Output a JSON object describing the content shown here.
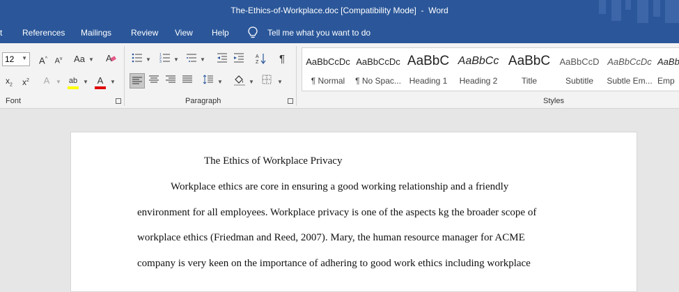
{
  "window": {
    "title": "The-Ethics-of-Workplace.doc [Compatibility Mode]  -  Word"
  },
  "menu": {
    "items": [
      "t",
      "References",
      "Mailings",
      "Review",
      "View",
      "Help"
    ],
    "tell_me": "Tell me what you want to do"
  },
  "ribbon": {
    "font_size": "12",
    "group_labels": {
      "font": "Font",
      "paragraph": "Paragraph",
      "styles": "Styles"
    },
    "styles": [
      {
        "sample": "AaBbCcDc",
        "name": "¶ Normal"
      },
      {
        "sample": "AaBbCcDc",
        "name": "¶ No Spac..."
      },
      {
        "sample": "AaBbC",
        "name": "Heading 1"
      },
      {
        "sample": "AaBbCc",
        "name": "Heading 2"
      },
      {
        "sample": "AaBbC",
        "name": "Title"
      },
      {
        "sample": "AaBbCcD",
        "name": "Subtitle"
      },
      {
        "sample": "AaBbCcDc",
        "name": "Subtle Em..."
      },
      {
        "sample": "AaBb",
        "name": "Emp"
      }
    ]
  },
  "colors": {
    "title_bar": "#2b579a",
    "ribbon": "#f3f3f3",
    "canvas": "#e6e6e6",
    "highlight": "#ffff00",
    "font_color": "#e00000"
  },
  "document": {
    "title": "The Ethics of Workplace Privacy",
    "lines": [
      "Workplace ethics are core in ensuring a good working relationship and a friendly",
      "environment for all employees. Workplace privacy is one of the aspects kg the broader scope of",
      "workplace ethics (Friedman and Reed, 2007). Mary, the human resource manager for ACME",
      "company is very keen on the importance of adhering to good work ethics including workplace"
    ]
  }
}
